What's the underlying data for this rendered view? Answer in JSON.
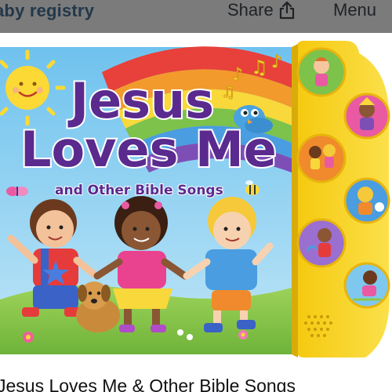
{
  "header": {
    "title": "aby registry",
    "share_label": "Share",
    "share_icon": "share-icon",
    "menu_label": "Menu"
  },
  "product": {
    "cover_title_line1": "Jesus",
    "cover_title_line2": "Loves Me",
    "cover_subtitle": "and Other Bible Songs",
    "title": "Jesus Loves Me & Other Bible Songs"
  },
  "colors": {
    "header_bg": "#7b7b7b",
    "title_purple": "#5a2a8e",
    "sound_panel_yellow": "#f7d21a",
    "sky_blue": "#7ec8ef",
    "grass_green": "#8cc84b"
  }
}
